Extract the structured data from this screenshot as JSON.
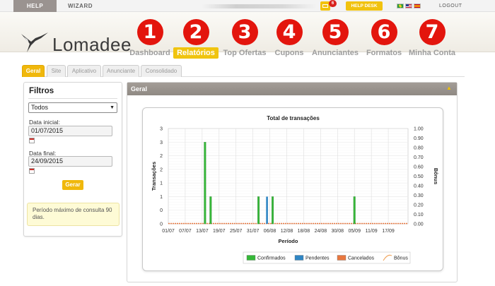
{
  "topbar": {
    "help_label": "HELP",
    "wizard_label": "WIZARD",
    "mail_count": "6",
    "helpdesk_label": "HELP DESK",
    "logout_label": "LOGOUT",
    "flags": [
      "flag-br-icon",
      "flag-us-icon",
      "flag-es-icon"
    ]
  },
  "header": {
    "logo_text": "Lomadee",
    "nav": [
      {
        "num": "1",
        "label": "Dashboard",
        "active": false
      },
      {
        "num": "2",
        "label": "Relatórios",
        "active": true
      },
      {
        "num": "3",
        "label": "Top Ofertas",
        "active": false
      },
      {
        "num": "4",
        "label": "Cupons",
        "active": false
      },
      {
        "num": "5",
        "label": "Anunciantes",
        "active": false
      },
      {
        "num": "6",
        "label": "Formatos",
        "active": false
      },
      {
        "num": "7",
        "label": "Minha Conta",
        "active": false
      }
    ]
  },
  "tabs": [
    "Geral",
    "Site",
    "Aplicativo",
    "Anunciante",
    "Consolidado"
  ],
  "filters": {
    "title": "Filtros",
    "select_value": "Todos",
    "start_label": "Data inicial:",
    "start_value": "01/07/2015",
    "end_label": "Data final:",
    "end_value": "24/09/2015",
    "button_label": "Gerar",
    "note": "Período máximo de consulta 90 dias."
  },
  "main": {
    "panel_title": "Geral"
  },
  "colors": {
    "accent": "#f0b80c",
    "nav_badge": "#e3150d",
    "confirmados": "#35b838",
    "pendentes": "#2f86c4",
    "cancelados": "#e8773f",
    "bonus": "#f0a35a"
  },
  "chart_data": {
    "type": "bar",
    "title": "Total de transações",
    "xlabel": "Período",
    "ylabel": "Transações",
    "y2label": "Bônus",
    "ylim": [
      0,
      3
    ],
    "y2lim": [
      0,
      1
    ],
    "y_ticks": [
      "0",
      "0",
      "1",
      "1",
      "2",
      "2",
      "3",
      "3"
    ],
    "y_tick_values": [
      0,
      0.5,
      1,
      1.5,
      2,
      2.5,
      3,
      3.5
    ],
    "y2_ticks": [
      "0.00",
      "0.10",
      "0.20",
      "0.30",
      "0.40",
      "0.50",
      "0.60",
      "0.70",
      "0.80",
      "0.90",
      "1.00"
    ],
    "x_ticks": [
      "01/07",
      "07/07",
      "13/07",
      "19/07",
      "25/07",
      "31/07",
      "06/08",
      "12/08",
      "18/08",
      "24/08",
      "30/08",
      "05/09",
      "11/09",
      "17/09"
    ],
    "x_tick_days": [
      0,
      6,
      12,
      18,
      24,
      30,
      36,
      42,
      48,
      54,
      60,
      66,
      72,
      78
    ],
    "x_range_days": [
      0,
      85
    ],
    "grid": true,
    "legend": "bottom-center",
    "series": [
      {
        "name": "Confirmados",
        "kind": "bar",
        "points": [
          {
            "day": 13,
            "value": 3
          },
          {
            "day": 15,
            "value": 1
          },
          {
            "day": 32,
            "value": 1
          },
          {
            "day": 37,
            "value": 1
          },
          {
            "day": 66,
            "value": 1
          }
        ]
      },
      {
        "name": "Pendentes",
        "kind": "bar",
        "points": [
          {
            "day": 35,
            "value": 1
          }
        ]
      },
      {
        "name": "Cancelados",
        "kind": "bar",
        "points": []
      },
      {
        "name": "Bônus",
        "kind": "line",
        "points": []
      }
    ]
  }
}
